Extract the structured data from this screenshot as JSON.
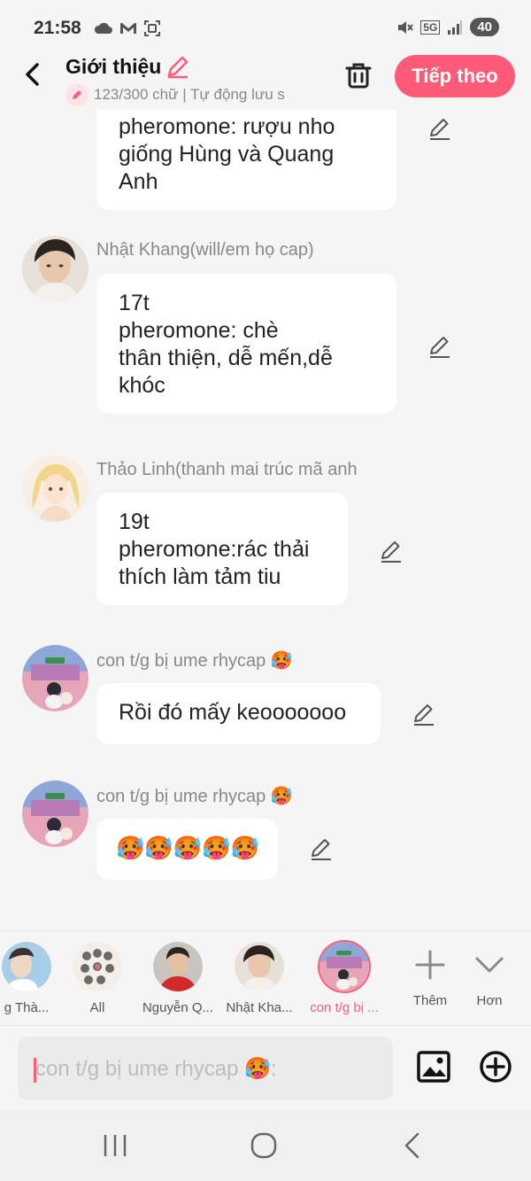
{
  "status_bar": {
    "time": "21:58",
    "network": "5G",
    "battery": "40"
  },
  "header": {
    "title": "Giới thiệu",
    "subtitle": "123/300 chữ | Tự động lưu s",
    "next_label": "Tiếp theo"
  },
  "messages": [
    {
      "sender": "",
      "lines": [
        "pheromone: rượu nho",
        "giống Hùng và Quang",
        "Anh"
      ]
    },
    {
      "sender": "Nhật Khang(will/em họ cap)",
      "lines": [
        "17t",
        "pheromone: chè",
        "thân thiện, dễ mến,dễ",
        "khóc"
      ]
    },
    {
      "sender": "Thảo Linh(thanh mai trúc mã anh",
      "lines": [
        "19t",
        "pheromone:rác thải",
        "thích làm tảm tiu"
      ]
    },
    {
      "sender": "con t/g bị ume rhycap 🥵",
      "lines": [
        "Rồi đó mấy keooooooo"
      ]
    },
    {
      "sender": "con t/g bị ume rhycap 🥵",
      "lines": [
        "🥵🥵🥵🥵🥵"
      ]
    }
  ],
  "characters": [
    {
      "name": "g Thà..."
    },
    {
      "name": "All"
    },
    {
      "name": "Nguyễn Q..."
    },
    {
      "name": "Nhật Kha..."
    },
    {
      "name": "con t/g bị ..."
    }
  ],
  "tools": {
    "add_label": "Thêm",
    "more_label": "Hơn"
  },
  "input": {
    "placeholder": "con t/g bị ume rhycap 🥵:"
  },
  "colors": {
    "accent": "#ff5a78",
    "background": "#f5f5f5",
    "bubble": "#ffffff"
  }
}
